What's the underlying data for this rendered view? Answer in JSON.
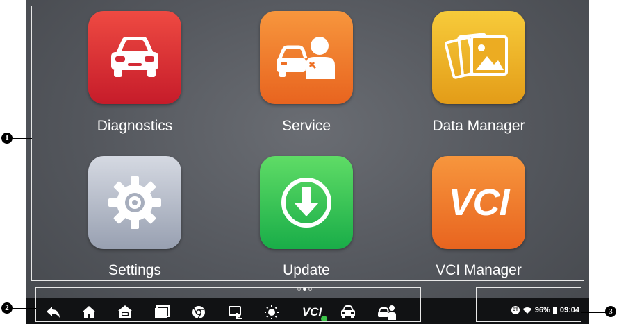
{
  "apps": [
    {
      "label": "Diagnostics",
      "icon": "car-front-icon"
    },
    {
      "label": "Service",
      "icon": "car-mechanic-icon"
    },
    {
      "label": "Data Manager",
      "icon": "photo-gallery-icon"
    },
    {
      "label": "Settings",
      "icon": "gear-icon"
    },
    {
      "label": "Update",
      "icon": "download-arrow-icon"
    },
    {
      "label": "VCI Manager",
      "icon": "vci-icon",
      "icon_text": "VCI"
    }
  ],
  "navbar": {
    "items": [
      "back-icon",
      "home-icon",
      "car-home-icon",
      "recent-apps-icon",
      "browser-icon",
      "screenshot-icon",
      "brightness-icon",
      "vci-bt-icon",
      "car-diagnostics-icon",
      "car-service-icon"
    ],
    "vci_label": "VCI"
  },
  "status": {
    "bt_label": "BT",
    "battery": "96%",
    "time": "09:04"
  },
  "page_indicator": {
    "pages": 3,
    "current": 2
  },
  "callouts": [
    "1",
    "2",
    "3"
  ],
  "colors": {
    "diagnostics": "#d9303a",
    "service": "#f07a2c",
    "data_manager": "#f0b42a",
    "settings": "#b2b8c6",
    "update": "#2fc456",
    "vci_manager": "#f07a2c"
  }
}
